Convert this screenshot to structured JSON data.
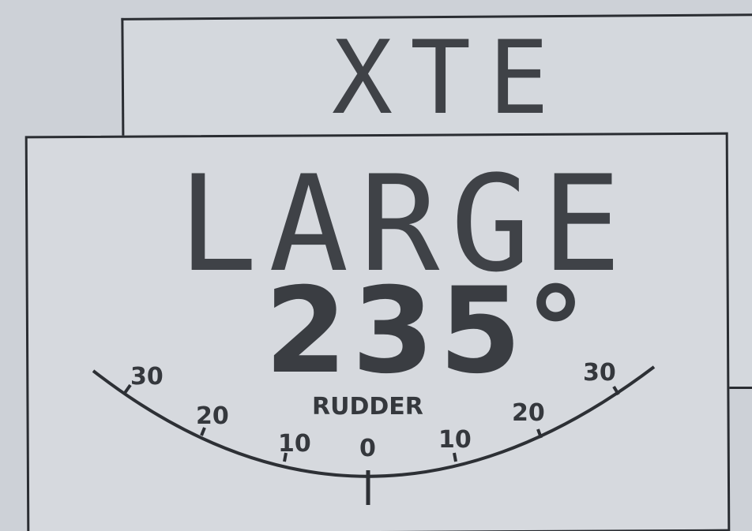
{
  "display": {
    "mode_label": "XTE",
    "status_label": "LARGE",
    "heading_value": "235°"
  },
  "rudder_indicator": {
    "title": "RUDDER",
    "scale_labels": {
      "left_30": "30",
      "left_20": "20",
      "left_10": "10",
      "center_0": "0",
      "right_10": "10",
      "right_20": "20",
      "right_30": "30"
    },
    "rudder_angle": 0
  },
  "colors": {
    "lcd_background": "#d6d9de",
    "segment_ink": "#3a3d42"
  }
}
